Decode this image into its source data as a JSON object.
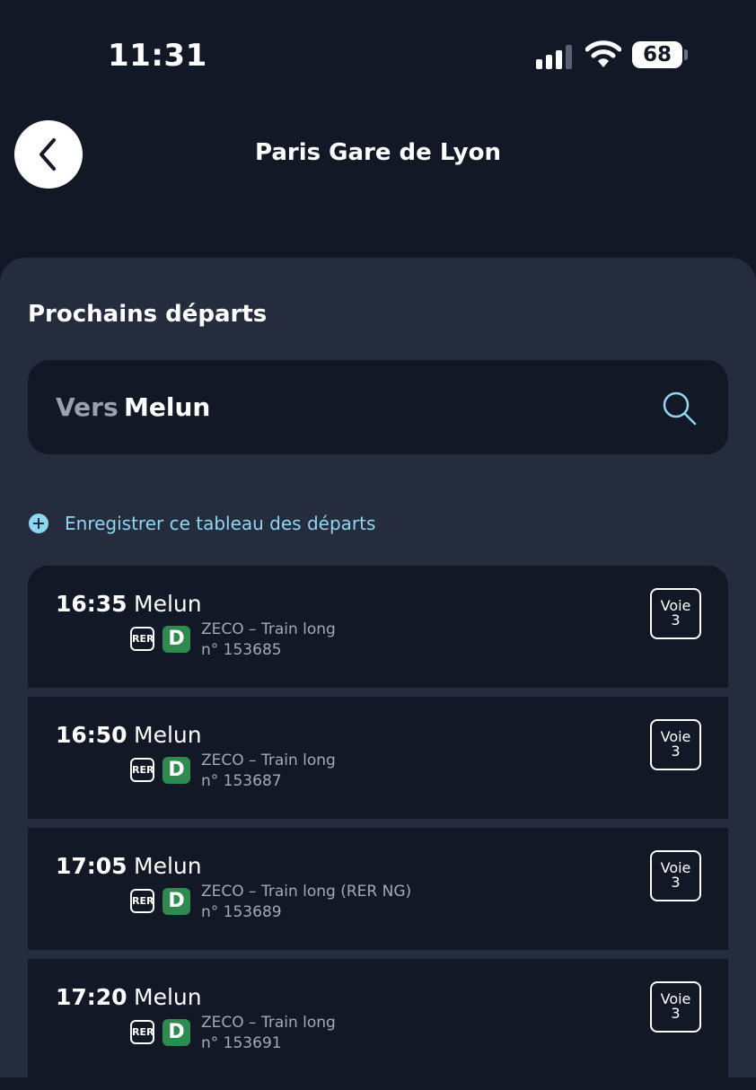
{
  "status_bar": {
    "time": "11:31",
    "battery": "68",
    "icons": [
      "signal-icon",
      "wifi-icon",
      "battery-icon"
    ]
  },
  "header": {
    "title": "Paris Gare de Lyon",
    "back_icon": "chevron-left-icon"
  },
  "section_title": "Prochains départs",
  "search": {
    "prefix": "Vers",
    "value": "Melun",
    "icon": "search-icon"
  },
  "save_link": {
    "label": "Enregistrer ce tableau des départs",
    "icon": "plus-circle-icon"
  },
  "departures": [
    {
      "time": "16:35",
      "destination": "Melun",
      "network": "RER",
      "line": "D",
      "service": "ZECO – Train long",
      "number": "n° 153685",
      "voie_label": "Voie",
      "voie": "3"
    },
    {
      "time": "16:50",
      "destination": "Melun",
      "network": "RER",
      "line": "D",
      "service": "ZECO – Train long",
      "number": "n° 153687",
      "voie_label": "Voie",
      "voie": "3"
    },
    {
      "time": "17:05",
      "destination": "Melun",
      "network": "RER",
      "line": "D",
      "service": "ZECO – Train long (RER NG)",
      "number": "n° 153689",
      "voie_label": "Voie",
      "voie": "3"
    },
    {
      "time": "17:20",
      "destination": "Melun",
      "network": "RER",
      "line": "D",
      "service": "ZECO – Train long",
      "number": "n° 153691",
      "voie_label": "Voie",
      "voie": "3"
    }
  ],
  "colors": {
    "background": "#121826",
    "panel": "#252c3d",
    "accent": "#8fd6f0",
    "line_d": "#2f8a4f"
  }
}
